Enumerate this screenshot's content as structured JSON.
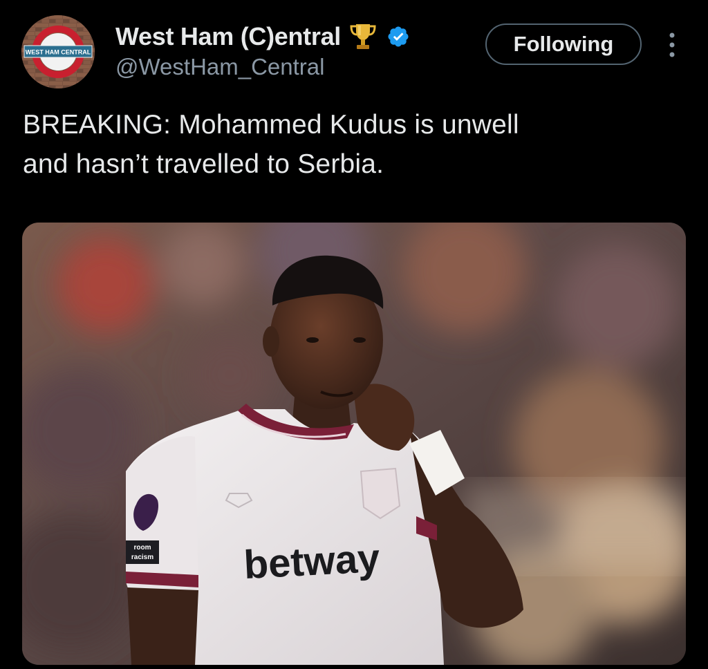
{
  "tweet": {
    "author": {
      "display_name": "West Ham (C)entral",
      "handle": "@WestHam_Central",
      "avatar_text": "WEST HAM CENTRAL",
      "badges": [
        "trophy-icon",
        "verified-icon"
      ]
    },
    "follow_button_label": "Following",
    "more_icon": "more-icon",
    "text_line1": "BREAKING: Mohammed Kudus is unwell",
    "text_line2": "and hasn’t travelled to Serbia.",
    "media": {
      "shirt_sponsor": "betway",
      "sleeve_patch": "No room for racism"
    }
  },
  "colors": {
    "background": "#000000",
    "text_primary": "#e7e9ea",
    "text_secondary": "#8b98a5",
    "verified": "#1d9bf0",
    "trophy": "#e8b83a",
    "follow_border": "#536471"
  }
}
